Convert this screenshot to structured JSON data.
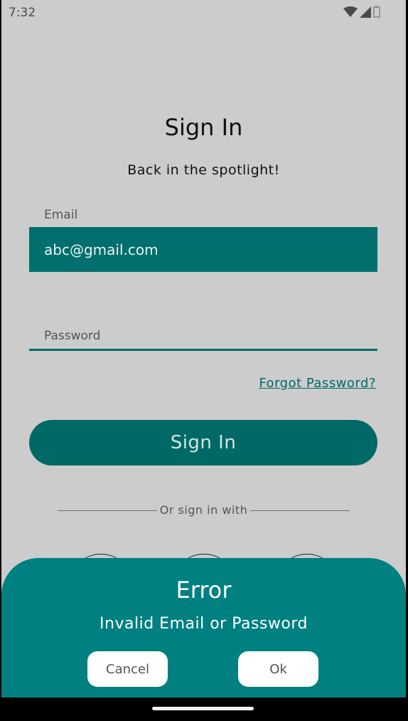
{
  "status_bar": {
    "time": "7:32",
    "icons": [
      "wifi-icon",
      "signal-icon",
      "battery-icon"
    ]
  },
  "sign_in": {
    "title": "Sign In",
    "subtitle": "Back in the spotlight!",
    "email_label": "Email",
    "email_value": "abc@gmail.com",
    "password_label": "Password",
    "forgot_password": "Forgot Password?",
    "sign_in_button": "Sign In",
    "divider_text": "Or sign in with"
  },
  "error_dialog": {
    "title": "Error",
    "message": "Invalid Email or Password",
    "cancel_label": "Cancel",
    "ok_label": "Ok"
  },
  "colors": {
    "background": "#cccccc",
    "primary": "#006f6d",
    "sheet": "#008080",
    "white": "#ffffff"
  }
}
